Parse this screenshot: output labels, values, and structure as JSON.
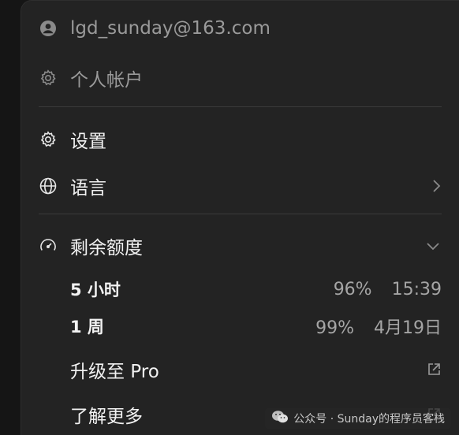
{
  "account": {
    "email": "lgd_sunday@163.com",
    "personal_account": "个人帐户"
  },
  "menu": {
    "settings": "设置",
    "language": "语言"
  },
  "quota": {
    "title": "剩余额度",
    "rows": [
      {
        "label": "5 小时",
        "percent": "96%",
        "reset": "15:39"
      },
      {
        "label": "1 周",
        "percent": "99%",
        "reset": "4月19日"
      }
    ]
  },
  "links": {
    "upgrade": "升级至 Pro",
    "learn_more": "了解更多"
  },
  "watermark": {
    "text": "公众号 · Sunday的程序员客栈"
  },
  "icons": [
    "user-circle-icon",
    "gear-icon",
    "globe-icon",
    "chevron-right-icon",
    "gauge-icon",
    "chevron-down-icon",
    "external-link-icon",
    "wechat-icon"
  ],
  "colors": {
    "menu_bg": "#232323",
    "page_bg": "#151515",
    "text": "#f2f2f2",
    "muted": "#9a9a9a",
    "divider": "#3b3b3b"
  }
}
